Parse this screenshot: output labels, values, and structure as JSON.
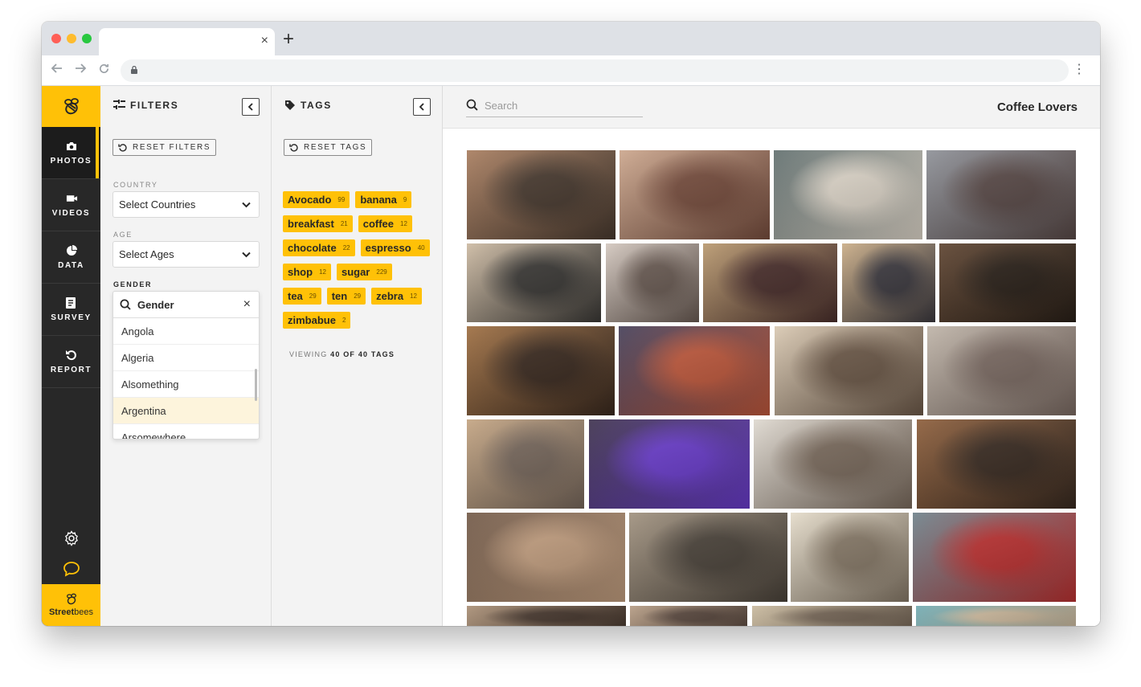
{
  "browser": {
    "traffic_lights": [
      "#ff5f57",
      "#febc2e",
      "#28c840"
    ],
    "new_tab_label": "+",
    "tab_close_label": "×",
    "menu_label": "⋮"
  },
  "colors": {
    "brand": "#ffc107",
    "nav_bg": "#282828",
    "panel_bg": "#f3f3f3"
  },
  "nav": {
    "items": [
      {
        "label": "PHOTOS",
        "icon": "camera-icon",
        "active": true
      },
      {
        "label": "VIDEOS",
        "icon": "video-icon",
        "active": false
      },
      {
        "label": "DATA",
        "icon": "pie-chart-icon",
        "active": false
      },
      {
        "label": "SURVEY",
        "icon": "document-icon",
        "active": false
      },
      {
        "label": "REPORT",
        "icon": "rotate-icon",
        "active": false
      }
    ],
    "brand_prefix": "Street",
    "brand_suffix": "bees"
  },
  "filters": {
    "title": "FILTERS",
    "reset_label": "RESET FILTERS",
    "country_label": "COUNTRY",
    "country_value": "Select Countries",
    "age_label": "AGE",
    "age_value": "Select Ages",
    "gender_label": "GENDER",
    "gender_search": "Gender",
    "gender_clear": "×",
    "options": [
      "Angola",
      "Algeria",
      "Alsomething",
      "Argentina",
      "Arsomewhere"
    ],
    "selected_option": "Argentina"
  },
  "tags": {
    "title": "TAGS",
    "reset_label": "RESET TAGS",
    "rows": [
      [
        {
          "name": "Avocado",
          "count": "99"
        },
        {
          "name": "banana",
          "count": "9"
        }
      ],
      [
        {
          "name": "breakfast",
          "count": "21"
        },
        {
          "name": "coffee",
          "count": "12"
        }
      ],
      [
        {
          "name": "chocolate",
          "count": "22"
        },
        {
          "name": "espresso",
          "count": "40"
        }
      ],
      [
        {
          "name": "shop",
          "count": "12"
        },
        {
          "name": "sugar",
          "count": "229"
        }
      ],
      [
        {
          "name": "tea",
          "count": "29"
        },
        {
          "name": "ten",
          "count": "29"
        },
        {
          "name": "zebra",
          "count": "12"
        }
      ],
      [
        {
          "name": "zimbabue",
          "count": "2"
        }
      ]
    ],
    "viewing_prefix": "VIEWING",
    "viewing_count": "40 OF 40 TAGS"
  },
  "main": {
    "search_placeholder": "Search",
    "title": "Coffee Lovers",
    "photo_count": 27
  }
}
